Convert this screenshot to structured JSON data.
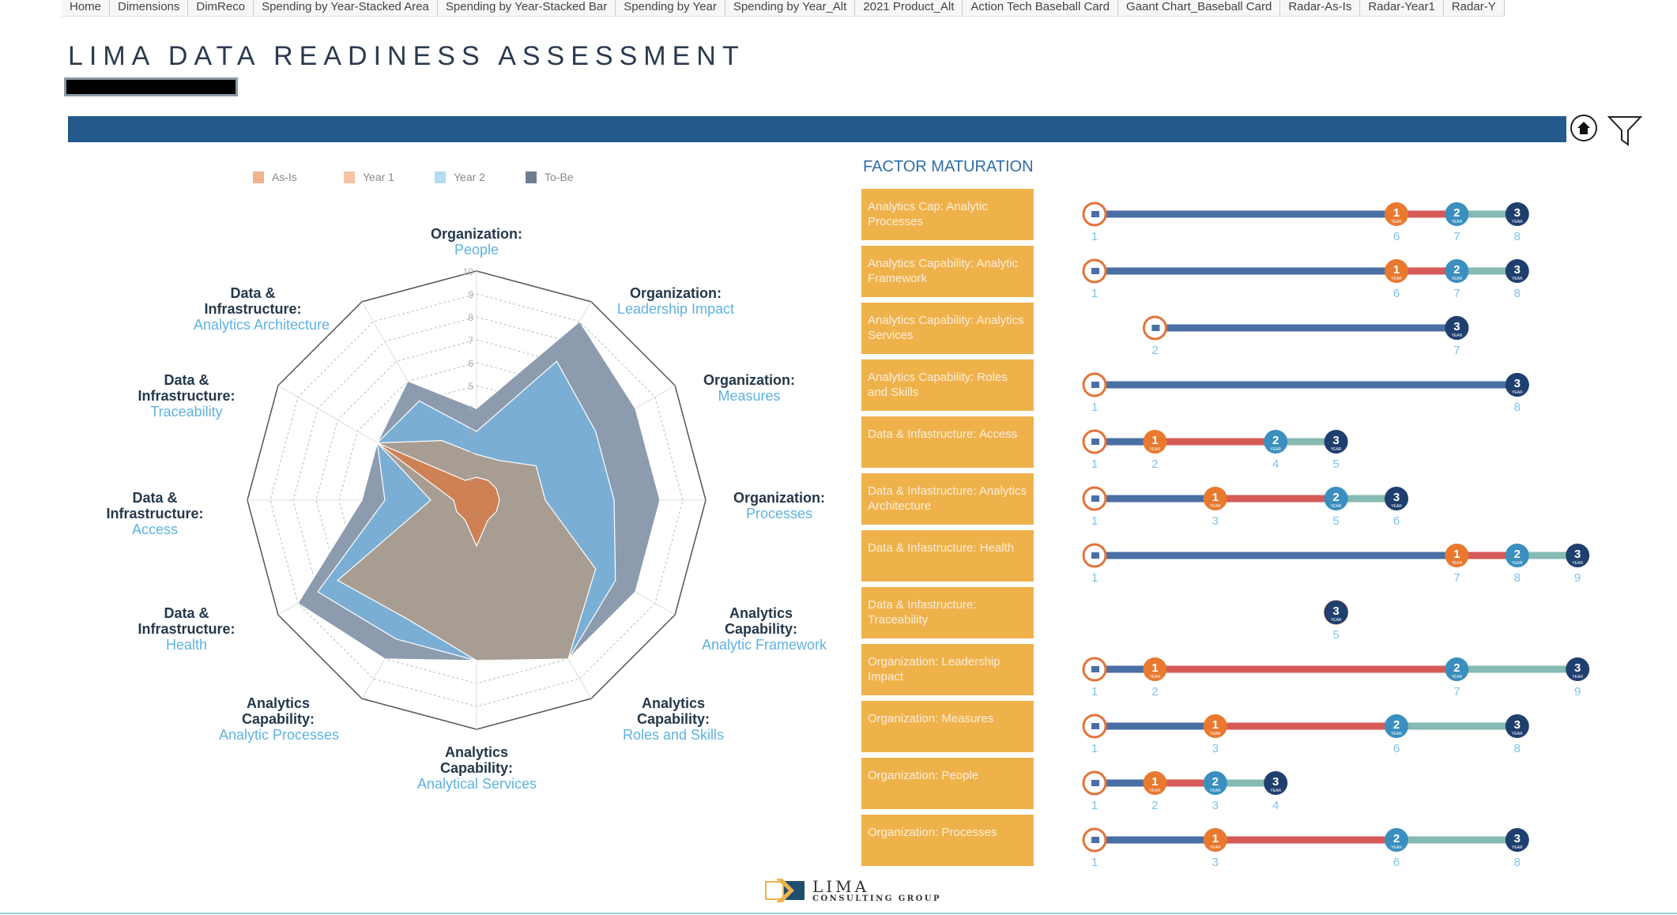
{
  "tabs": [
    "Home",
    "Dimensions",
    "DimReco",
    "Spending by Year-Stacked Area",
    "Spending by Year-Stacked Bar",
    "Spending by Year",
    "Spending by Year_Alt",
    "2021 Product_Alt",
    "Action Tech Baseball Card",
    "Gaant Chart_Baseball Card",
    "Radar-As-Is",
    "Radar-Year1",
    "Radar-Y"
  ],
  "header": {
    "title": "LIMA DATA READINESS ASSESSMENT",
    "home_icon": "home-icon",
    "filter_icon": "filter-icon",
    "bar_color": "#245a8c"
  },
  "factor_title": "FACTOR MATURATION",
  "logo": {
    "line1": "LIMA",
    "line2": "CONSULTING GROUP"
  },
  "chart_data": [
    {
      "type": "radar",
      "rlim": [
        0,
        10
      ],
      "ticks": [
        "1",
        "2",
        "3",
        "4",
        "5",
        "6",
        "7",
        "8",
        "9",
        "10"
      ],
      "legend_position": "top",
      "axes": [
        {
          "group": "Organization:",
          "name": "People"
        },
        {
          "group": "Organization:",
          "name": "Leadership Impact"
        },
        {
          "group": "Organization:",
          "name": "Measures"
        },
        {
          "group": "Organization:",
          "name": "Processes"
        },
        {
          "group": "Analytics Capability:",
          "name": "Analytic Framework"
        },
        {
          "group": "Analytics Capability:",
          "name": "Roles and Skills"
        },
        {
          "group": "Analytics Capability:",
          "name": "Analytical Services"
        },
        {
          "group": "Analytics Capability:",
          "name": "Analytic Processes"
        },
        {
          "group": "Data & Infrastructure:",
          "name": "Health"
        },
        {
          "group": "Data & Infrastructure:",
          "name": "Access"
        },
        {
          "group": "Data & Infrastructure:",
          "name": "Traceability"
        },
        {
          "group": "Data & Infrastructure:",
          "name": "Analytics Architecture"
        }
      ],
      "series": [
        {
          "name": "As-Is",
          "legend_color": "#f0b48f",
          "fill": "#d08050",
          "values": [
            1,
            1,
            1,
            1,
            1,
            1,
            2,
            1,
            1,
            1,
            5,
            1
          ]
        },
        {
          "name": "Year 1",
          "legend_color": "#f5c4a5",
          "fill": "#ab9c8f",
          "values": [
            2,
            2,
            3,
            3,
            6,
            8,
            7,
            6,
            7,
            2,
            5,
            3
          ]
        },
        {
          "name": "Year 2",
          "legend_color": "#b5dcf3",
          "fill": "#7aafd6",
          "values": [
            3,
            7,
            6,
            6,
            7,
            8,
            7,
            7,
            8,
            4,
            5,
            5
          ]
        },
        {
          "name": "To-Be",
          "legend_color": "#6e7d90",
          "fill": "#8796ab",
          "values": [
            4,
            9,
            8,
            8,
            8,
            8,
            7,
            8,
            9,
            5,
            5,
            6
          ]
        }
      ]
    },
    {
      "type": "dumbbell",
      "title": "FACTOR MATURATION",
      "xlim": [
        1,
        9
      ],
      "marker_labels": {
        "year": "YEAR"
      },
      "colors": {
        "as_is": "#e2743a",
        "year1": "#e8792f",
        "year2": "#3a8fbf",
        "year3": "#1f3f6e",
        "seg_now": "#4a6fa5",
        "seg_y1": "#d65a58",
        "seg_y2": "#86bab2",
        "value": "#7cc3e8"
      },
      "rows": [
        {
          "label": "Analytics Cap: Analytic Processes",
          "as_is": 1,
          "year1": 6,
          "year2": 7,
          "year3": 8
        },
        {
          "label": "Analytics Capability: Analytic Framework",
          "as_is": 1,
          "year1": 6,
          "year2": 7,
          "year3": 8
        },
        {
          "label": "Analytics Capability: Analytics Services",
          "as_is": 2,
          "year1": 7,
          "year2": 7,
          "year3": 7
        },
        {
          "label": "Analytics Capability: Roles and Skills",
          "as_is": 1,
          "year1": 8,
          "year2": 8,
          "year3": 8
        },
        {
          "label": "Data & Infastructure: Access",
          "as_is": 1,
          "year1": 2,
          "year2": 4,
          "year3": 5
        },
        {
          "label": "Data & Infastructure: Analytics Architecture",
          "as_is": 1,
          "year1": 3,
          "year2": 5,
          "year3": 6
        },
        {
          "label": "Data & Infastructure: Health",
          "as_is": 1,
          "year1": 7,
          "year2": 8,
          "year3": 9
        },
        {
          "label": "Data & Infastructure: Traceability",
          "as_is": 5,
          "year1": 5,
          "year2": 5,
          "year3": 5
        },
        {
          "label": "Organization: Leadership Impact",
          "as_is": 1,
          "year1": 2,
          "year2": 7,
          "year3": 9
        },
        {
          "label": "Organization: Measures",
          "as_is": 1,
          "year1": 3,
          "year2": 6,
          "year3": 8
        },
        {
          "label": "Organization: People",
          "as_is": 1,
          "year1": 2,
          "year2": 3,
          "year3": 4
        },
        {
          "label": "Organization: Processes",
          "as_is": 1,
          "year1": 3,
          "year2": 6,
          "year3": 8
        }
      ]
    }
  ]
}
